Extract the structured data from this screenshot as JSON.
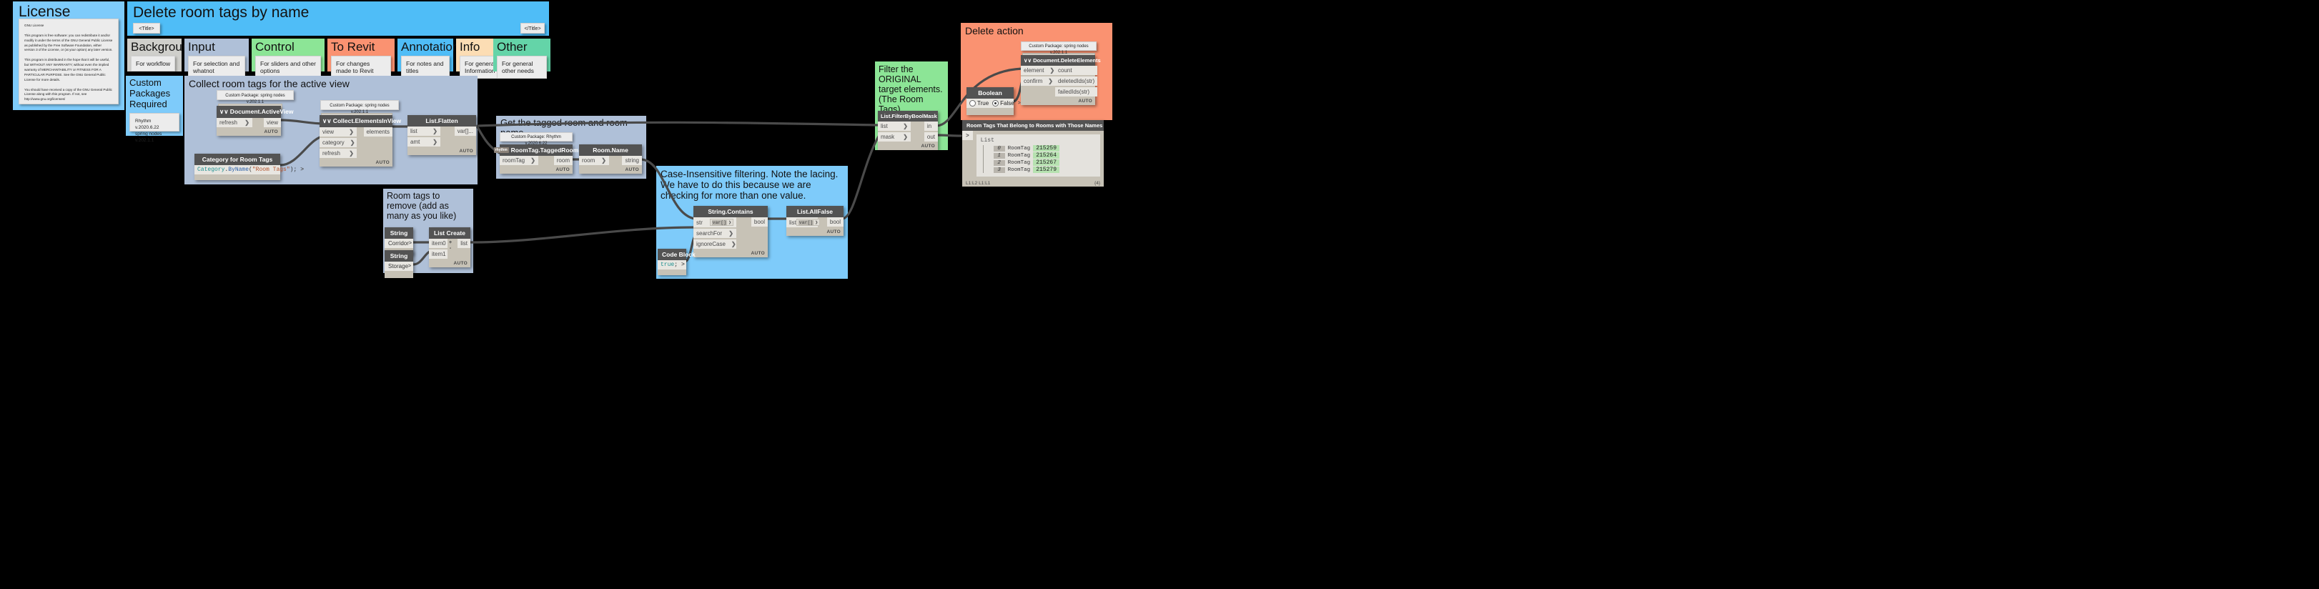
{
  "license_group": {
    "title": "License",
    "note": "GNU License\n\nThis program is free software: you can redistribute it and/or modify it under the terms of the GNU General Public License as published by the Free Software Foundation, either version 3 of the License, or (at your option) any later version.\n\nThis program is distributed in the hope that it will be useful, but WITHOUT ANY WARRANTY; without even the implied warranty of MERCHANTABILITY or FITNESS FOR A PARTICULAR PURPOSE. See the GNU General Public License for more details.\n\nYou should have received a copy of the GNU General Public License along with this program. If not, see http://www.gnu.org/licenses/"
  },
  "title_group": {
    "title": "Delete room tags by name",
    "tag_left": "<Title>",
    "tag_right": "</Title>"
  },
  "legend": [
    {
      "title": "Background",
      "note": "For workflow",
      "color": "#cfcfcb"
    },
    {
      "title": "Input",
      "note": "For selection and whatnot",
      "color": "#afc0d8"
    },
    {
      "title": "Control",
      "note": "For sliders and other options",
      "color": "#8ce596"
    },
    {
      "title": "To Revit",
      "note": "For changes made to Revit",
      "color": "#fa9271"
    },
    {
      "title": "Annotation",
      "note": "For notes and titles",
      "color": "#4fbdf7"
    },
    {
      "title": "Info",
      "note": "For general Information",
      "color": "#fcddb4"
    },
    {
      "title": "Other",
      "note": "For general other needs",
      "color": "#64d4a8"
    }
  ],
  "packages_group": {
    "title": "Custom Packages Required",
    "note": "Rhythm v.2020.6.22\nspring nodes v.202.1.1"
  },
  "collect_group": {
    "title": "Collect room tags for the active view",
    "pkg_note_1": "Custom Package: spring nodes v.202.1.1",
    "pkg_note_2": "Custom Package: spring nodes v.202.1.1",
    "nodes": {
      "active_view": {
        "title": "∨∨ Document.ActiveView",
        "inputs": [
          "refresh"
        ],
        "outputs": [
          "view"
        ],
        "auto": "AUTO"
      },
      "category": {
        "title": "Category for Room Tags",
        "code": "Category.ByName(\"Room Tags\");",
        "code_tokens": [
          {
            "t": "Category",
            "c": "cls"
          },
          {
            "t": ".",
            "c": "pun"
          },
          {
            "t": "ByName",
            "c": "mth"
          },
          {
            "t": "(",
            "c": "pun"
          },
          {
            "t": "\"Room Tags\"",
            "c": "str"
          },
          {
            "t": ");",
            "c": "pun"
          }
        ]
      },
      "collect_elements": {
        "title": "∨∨ Collect.ElementsInView",
        "inputs": [
          "view",
          "category",
          "refresh"
        ],
        "outputs": [
          "elements"
        ],
        "auto": "AUTO"
      },
      "flatten": {
        "title": "List.Flatten",
        "inputs": [
          "list",
          "amt"
        ],
        "outputs": [
          "var[]..."
        ],
        "auto": "AUTO"
      }
    }
  },
  "tagged_group": {
    "title": "Get the tagged room and room name",
    "pkg_note": "Custom Package: Rhythm v.2020.6.22",
    "nodes": {
      "tagged_room": {
        "title": "RoomTag.TaggedRoom",
        "badge": "rhythm",
        "inputs": [
          "roomTag"
        ],
        "outputs": [
          "room"
        ],
        "auto": "AUTO"
      },
      "room_name": {
        "title": "Room.Name",
        "inputs": [
          "room"
        ],
        "outputs": [
          "string"
        ],
        "auto": "AUTO"
      }
    }
  },
  "remove_group": {
    "title": "Room tags to remove (add as many as you like)",
    "nodes": {
      "string1": {
        "title": "String",
        "value": "Corridor"
      },
      "string2": {
        "title": "String",
        "value": "Storage"
      },
      "list_create": {
        "title": "List Create",
        "inputs": [
          "item0",
          "item1"
        ],
        "outputs": [
          "list"
        ],
        "plus": "+",
        "minus": "-",
        "auto": "AUTO"
      }
    }
  },
  "filter_case_group": {
    "title": "Case-Insensitive filtering. Note the lacing. We have to do this because we are checking for more than one value.",
    "nodes": {
      "string_contains": {
        "title": "String.Contains",
        "inputs": [
          "str",
          "searchFor",
          "ignoreCase"
        ],
        "outputs": [
          "bool"
        ],
        "preview_str": "var[]",
        "auto": "AUTO"
      },
      "list_allfalse": {
        "title": "List.AllFalse",
        "inputs": [
          "list"
        ],
        "outputs": [
          "bool"
        ],
        "preview_list": "var[]",
        "auto": "AUTO"
      },
      "code_block": {
        "title": "Code Block",
        "code": "true;",
        "code_tokens": [
          {
            "t": "true",
            "c": "kw"
          },
          {
            "t": ";",
            "c": "pun"
          }
        ]
      }
    }
  },
  "filter_mask_group": {
    "title": "Filter the ORIGINAL target elements. (The Room Tags)",
    "nodes": {
      "filter_mask": {
        "title": "List.FilterByBoolMask",
        "inputs": [
          "list",
          "mask"
        ],
        "outputs": [
          "in",
          "out"
        ],
        "auto": "AUTO"
      }
    }
  },
  "delete_group": {
    "title": "Delete action",
    "pkg_note": "Custom Package: spring nodes v.202.1.1",
    "nodes": {
      "delete_elements": {
        "title": "∨∨ Document.DeleteElements",
        "inputs": [
          "element",
          "confirm"
        ],
        "outputs": [
          "count",
          "deletedIds(str)",
          "failedIds(str)"
        ],
        "auto": "AUTO"
      },
      "boolean": {
        "title": "Boolean",
        "option_true": "True",
        "option_false": "False",
        "selected": "False"
      }
    }
  },
  "watch_node": {
    "title": "Room Tags That Belong to Rooms with Those Names",
    "port": ">",
    "list_label": "List",
    "items": [
      {
        "index": "0",
        "type": "RoomTag",
        "value": "215259"
      },
      {
        "index": "1",
        "type": "RoomTag",
        "value": "215264"
      },
      {
        "index": "2",
        "type": "RoomTag",
        "value": "215267"
      },
      {
        "index": "3",
        "type": "RoomTag",
        "value": "215279"
      }
    ],
    "footer_left": "L1:L2  L1:L1",
    "footer_right": "{4}"
  },
  "colors": {
    "annotation_blue": "#4fbdf7",
    "input_blue": "#afc0d8",
    "control_green": "#8ce596",
    "revit_orange": "#fa9271",
    "info_tan": "#fcddb4",
    "other_teal": "#64d4a8",
    "background_gray": "#cfcfcb",
    "node_header": "#535353",
    "node_body": "#c7c2b6"
  }
}
